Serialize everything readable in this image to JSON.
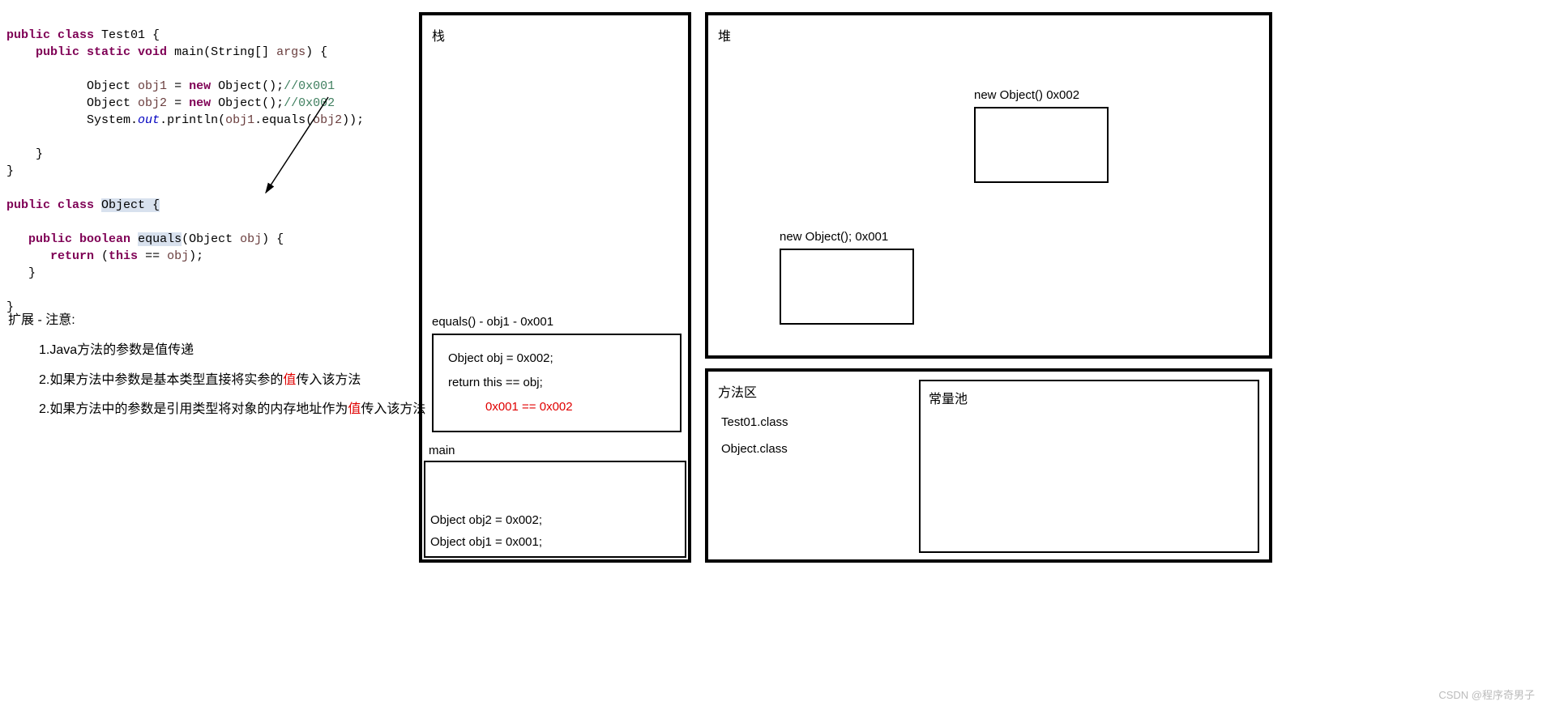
{
  "code": {
    "line1_mod": "public class",
    "line1_name": "Test01 {",
    "line2_mod": "public static void",
    "line2_name": "main",
    "line2_sig": "(String[] ",
    "line2_args": "args",
    "line2_end": ") {",
    "line4_type": "Object ",
    "line4_var": "obj1",
    "line4_eq": " = ",
    "line4_new": "new",
    "line4_call": " Object();",
    "line4_comment": "//0x001",
    "line5_type": "Object ",
    "line5_var": "obj2",
    "line5_eq": " = ",
    "line5_new": "new",
    "line5_call": " Object();",
    "line5_comment": "//0x002",
    "line6_a": "System.",
    "line6_out": "out",
    "line6_b": ".println(",
    "line6_c": "obj1",
    "line6_d": ".equals(",
    "line6_e": "obj2",
    "line6_f": "));",
    "line9_mod": "public class",
    "line9_name": "Object {",
    "line11_mod": "public boolean",
    "line11_name": "equals",
    "line11_sig": "(Object ",
    "line11_arg": "obj",
    "line11_end": ") {",
    "line12_ret": "return",
    "line12_a": " (",
    "line12_this": "this",
    "line12_b": " == ",
    "line12_c": "obj",
    "line12_d": ");"
  },
  "notes": {
    "title": "扩展 - 注意:",
    "item1": "1.Java方法的参数是值传递",
    "item2a": "2.如果方法中参数是基本类型直接将实参的",
    "item2b": "值",
    "item2c": "传入该方法",
    "item3a": "2.如果方法中的参数是引用类型将对象的内存地址作为",
    "item3b": "值",
    "item3c": "传入该方法"
  },
  "stack": {
    "title": "栈",
    "equals_label": "equals() - obj1 - 0x001",
    "equals_line1": "Object obj = 0x002;",
    "equals_line2": "return this == obj;",
    "equals_line3": "0x001 == 0x002",
    "main_label": "main",
    "main_line1": "Object obj2 = 0x002;",
    "main_line2": "Object obj1 = 0x001;"
  },
  "heap": {
    "title": "堆",
    "obj1_label": "new Object();  0x001",
    "obj2_label": "new Object()   0x002"
  },
  "method_area": {
    "title": "方法区",
    "item1": "Test01.class",
    "item2": "Object.class",
    "const_title": "常量池"
  },
  "watermark": "CSDN @程序奇男子"
}
